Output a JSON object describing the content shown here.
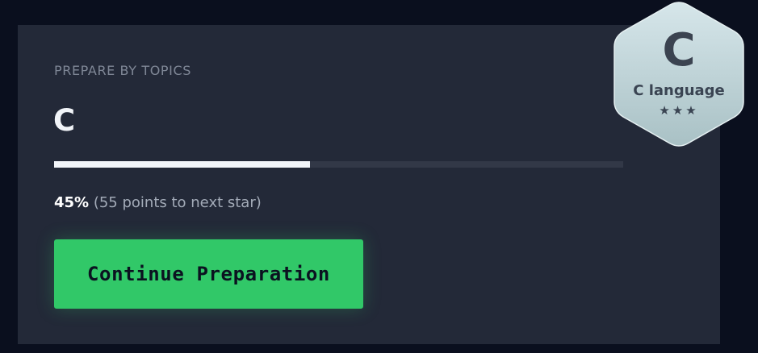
{
  "card": {
    "eyebrow": "PREPARE BY TOPICS",
    "title": "C",
    "progress": {
      "percent_value": 45,
      "percent_label": "45%",
      "detail": "(55 points to next star)"
    },
    "cta_label": "Continue Preparation"
  },
  "badge": {
    "letter": "C",
    "label": "C language",
    "stars": "★★★"
  },
  "colors": {
    "background": "#0a0f1e",
    "card": "#232938",
    "accent_green": "#31c868",
    "progress_fill": "#f2f5fa",
    "progress_track": "#323847",
    "badge": "#cfdfe3"
  }
}
